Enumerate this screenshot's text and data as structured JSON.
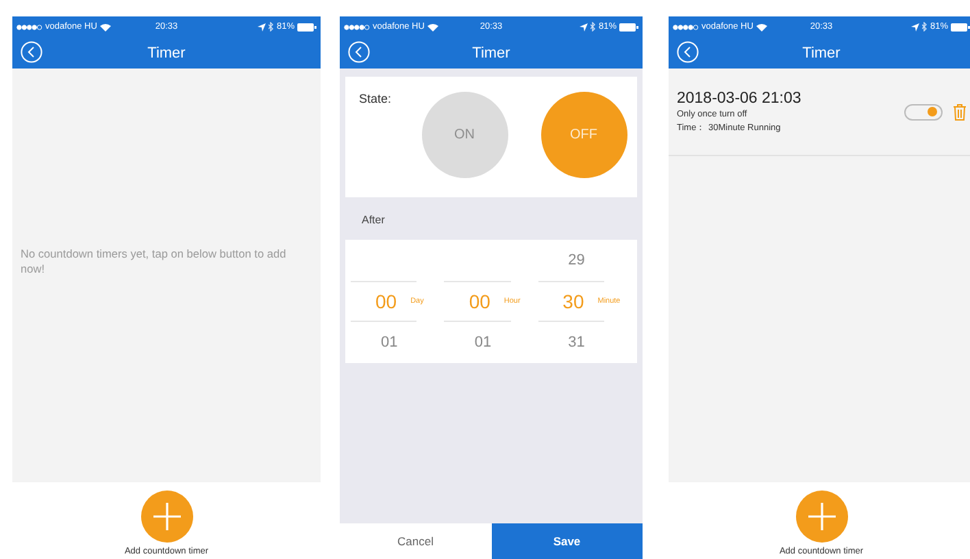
{
  "screens": [
    {
      "kind": "empty",
      "status_bar": {
        "carrier": "vodafone HU",
        "time": "20:33",
        "battery": "81%"
      },
      "title": "Timer",
      "empty_message": "No countdown timers yet, tap on below button to add now!",
      "add_label": "Add countdown timer"
    },
    {
      "kind": "edit",
      "status_bar": {
        "carrier": "vodafone HU",
        "time": "20:33",
        "battery": "81%"
      },
      "title": "Timer",
      "state_label": "State:",
      "state_options": [
        {
          "label": "ON",
          "selected": false
        },
        {
          "label": "OFF",
          "selected": true
        }
      ],
      "after_label": "After",
      "picker": [
        {
          "value": "00",
          "below": "01",
          "unit": "Day"
        },
        {
          "value": "00",
          "below": "01",
          "unit": "Hour"
        },
        {
          "above": "29",
          "value": "30",
          "below": "31",
          "unit": "Minute"
        }
      ],
      "buttons": [
        {
          "label": "Cancel",
          "kind": "secondary"
        },
        {
          "label": "Save",
          "kind": "primary"
        }
      ]
    },
    {
      "kind": "list",
      "status_bar": {
        "carrier": "vodafone HU",
        "time": "20:33",
        "battery": "81%"
      },
      "title": "Timer",
      "timers": [
        {
          "datetime": "2018-03-06 21:03",
          "repeat": "Only once turn off",
          "detail": "Time： 30Minute Running",
          "on": true
        }
      ],
      "add_label": "Add countdown timer"
    }
  ]
}
